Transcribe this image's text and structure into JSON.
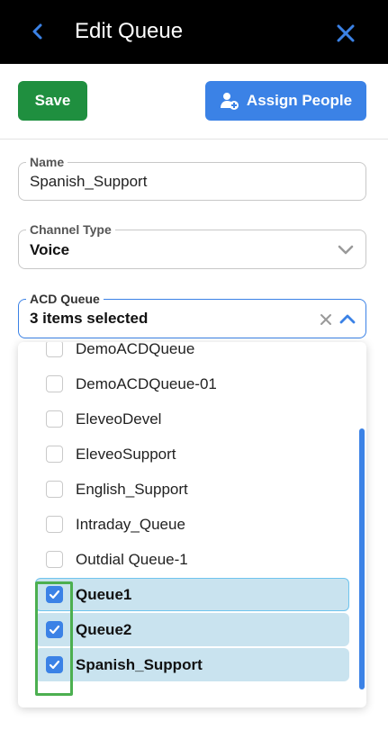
{
  "header": {
    "title": "Edit Queue",
    "back_icon": "chevron-left-icon",
    "close_icon": "close-icon"
  },
  "actions": {
    "save_label": "Save",
    "assign_label": "Assign People",
    "assign_icon": "person-add-icon"
  },
  "fields": {
    "name": {
      "label": "Name",
      "value": "Spanish_Support"
    },
    "channel_type": {
      "label": "Channel Type",
      "value": "Voice"
    },
    "acd_queue": {
      "label": "ACD Queue",
      "value": "3 items selected"
    }
  },
  "acd_options": [
    {
      "label": "DemoACDQueue",
      "checked": false
    },
    {
      "label": "DemoACDQueue-01",
      "checked": false
    },
    {
      "label": "EleveoDevel",
      "checked": false
    },
    {
      "label": "EleveoSupport",
      "checked": false
    },
    {
      "label": "English_Support",
      "checked": false
    },
    {
      "label": "Intraday_Queue",
      "checked": false
    },
    {
      "label": "Outdial Queue-1",
      "checked": false
    },
    {
      "label": "Queue1",
      "checked": true
    },
    {
      "label": "Queue2",
      "checked": true
    },
    {
      "label": "Spanish_Support",
      "checked": true
    }
  ],
  "colors": {
    "accent": "#3b82e6",
    "save": "#1f8f3f",
    "selected_bg": "#c9e3ef",
    "annotation": "#4caf50"
  }
}
